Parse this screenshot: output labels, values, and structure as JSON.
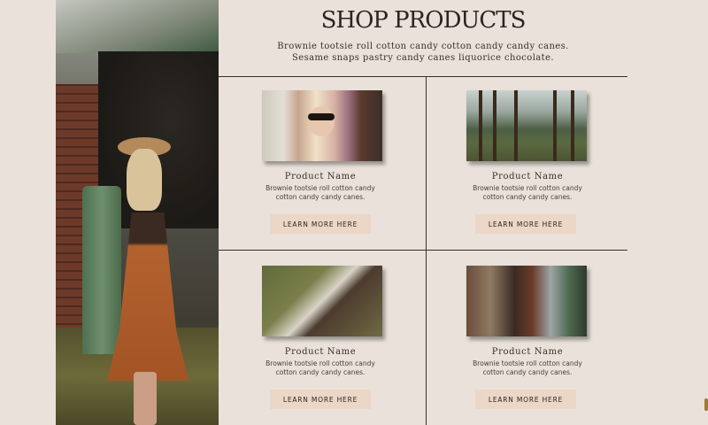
{
  "header": {
    "title": "SHOP PRODUCTS",
    "subtitle_line1": "Brownie tootsie roll cotton candy cotton candy candy canes.",
    "subtitle_line2": "Sesame snaps pastry candy canes liquorice chocolate."
  },
  "products": [
    {
      "name": "Product Name",
      "desc_line1": "Brownie tootsie roll cotton candy",
      "desc_line2": "cotton candy candy canes.",
      "button": "LEARN MORE HERE",
      "photo": "woman-sunglasses-photo"
    },
    {
      "name": "Product Name",
      "desc_line1": "Brownie tootsie roll cotton candy",
      "desc_line2": "cotton candy candy canes.",
      "button": "LEARN MORE HERE",
      "photo": "forest-flowers-photo"
    },
    {
      "name": "Product Name",
      "desc_line1": "Brownie tootsie roll cotton candy",
      "desc_line2": "cotton candy candy canes.",
      "button": "LEARN MORE HERE",
      "photo": "women-lying-in-grass-photo"
    },
    {
      "name": "Product Name",
      "desc_line1": "Brownie tootsie roll cotton candy",
      "desc_line2": "cotton candy candy canes.",
      "button": "LEARN MORE HERE",
      "photo": "shop-interior-photo"
    }
  ],
  "colors": {
    "background": "#e9e1da",
    "button": "#ecd6c6",
    "text": "#3a302b"
  }
}
